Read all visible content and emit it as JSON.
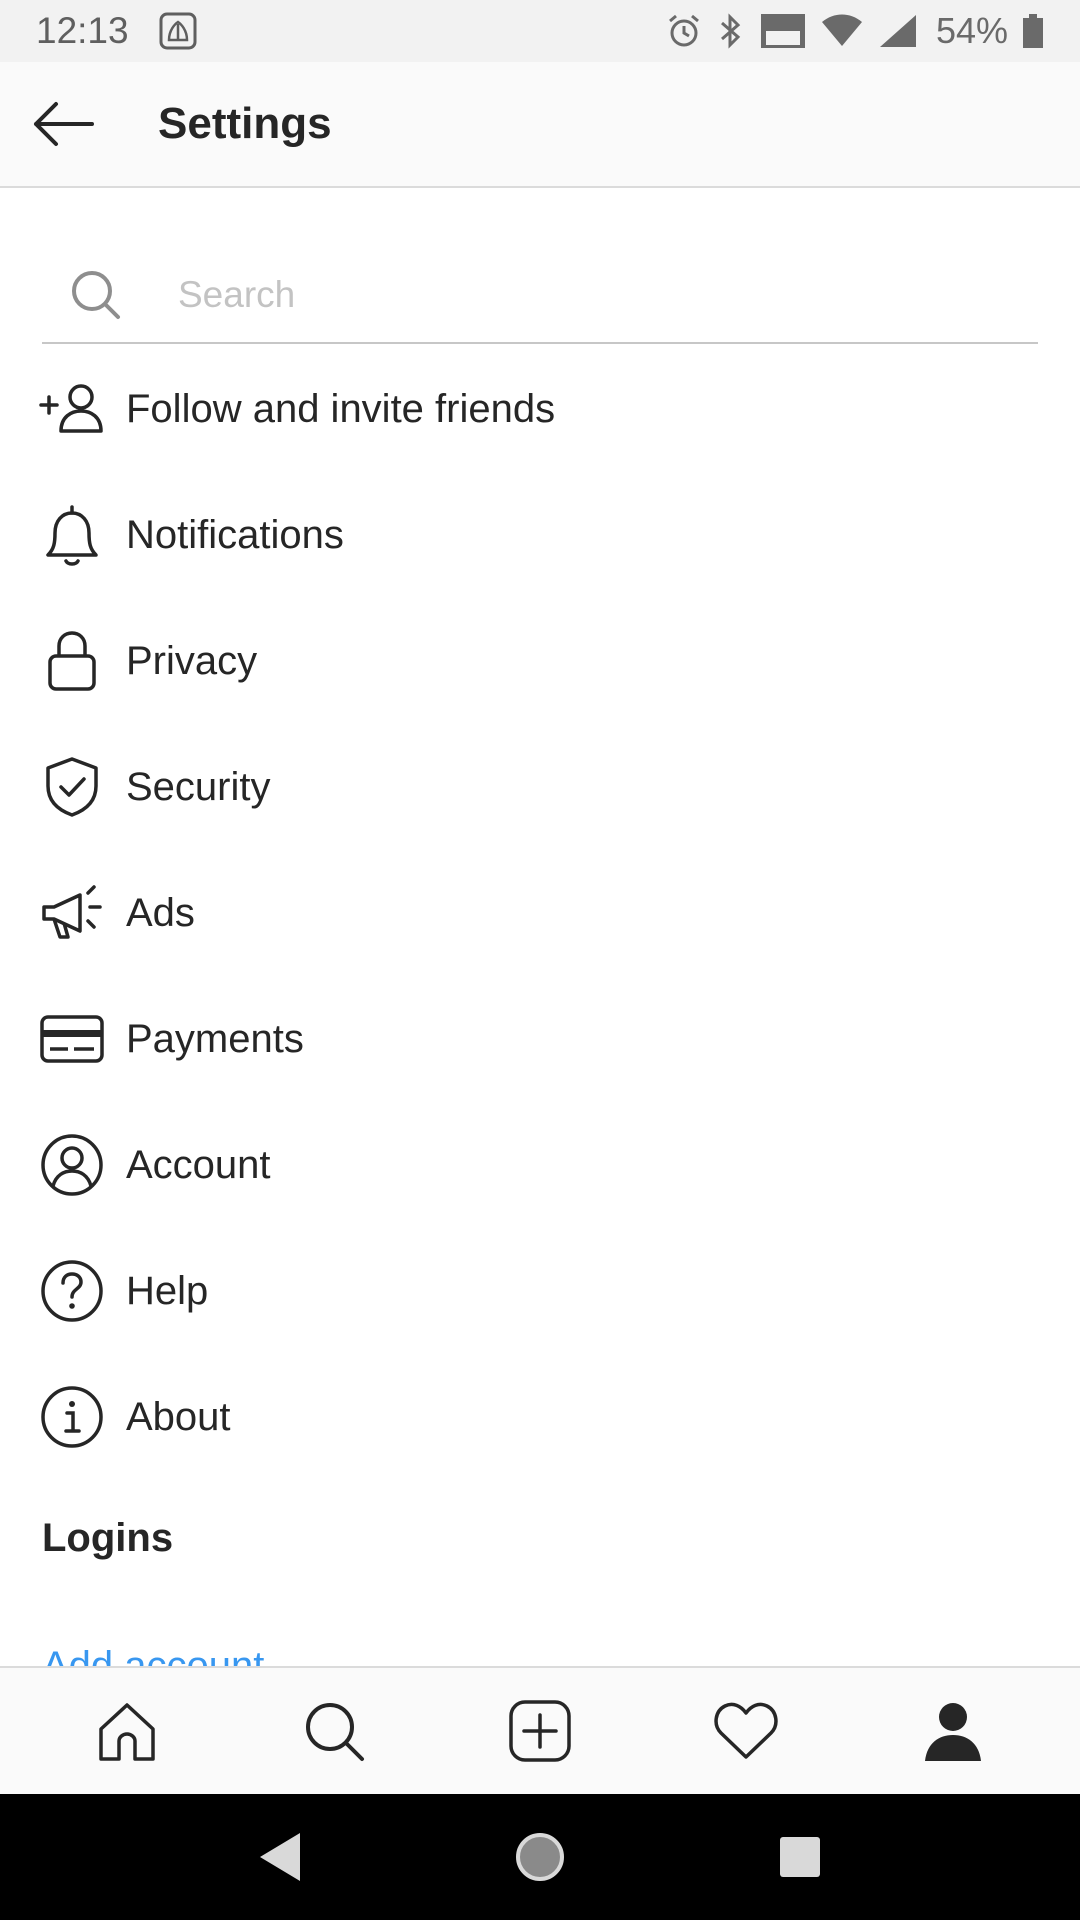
{
  "status_bar": {
    "time": "12:13",
    "battery": "54%"
  },
  "header": {
    "title": "Settings"
  },
  "search": {
    "placeholder": "Search",
    "value": ""
  },
  "menu": {
    "items": [
      {
        "label": "Follow and invite friends",
        "icon": "add-person-icon"
      },
      {
        "label": "Notifications",
        "icon": "bell-icon"
      },
      {
        "label": "Privacy",
        "icon": "lock-icon"
      },
      {
        "label": "Security",
        "icon": "shield-check-icon"
      },
      {
        "label": "Ads",
        "icon": "megaphone-icon"
      },
      {
        "label": "Payments",
        "icon": "credit-card-icon"
      },
      {
        "label": "Account",
        "icon": "user-circle-icon"
      },
      {
        "label": "Help",
        "icon": "help-circle-icon"
      },
      {
        "label": "About",
        "icon": "info-circle-icon"
      }
    ]
  },
  "logins": {
    "header": "Logins",
    "add_account": "Add account"
  },
  "bottom_nav": {
    "items": [
      "home-icon",
      "search-icon",
      "new-post-icon",
      "heart-icon",
      "profile-icon"
    ],
    "active": "profile-icon"
  },
  "colors": {
    "link": "#3897f0",
    "text": "#262626",
    "divider": "#dbdbdb"
  }
}
